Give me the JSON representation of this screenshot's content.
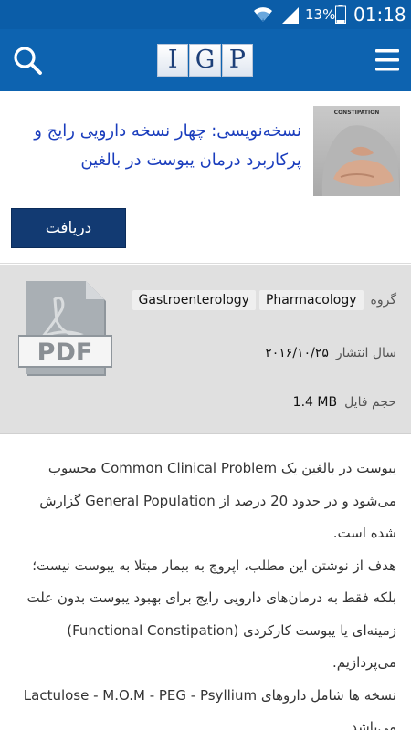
{
  "status_bar": {
    "battery_percent": "13%",
    "time": "01:18",
    "icons": [
      "wifi-icon",
      "signal-icon",
      "battery-icon"
    ]
  },
  "app_bar": {
    "logo_letters": [
      "I",
      "G",
      "P"
    ],
    "search_icon": "search-icon",
    "menu_icon": "hamburger-menu-icon",
    "background_color": "#0d63b0"
  },
  "article": {
    "title": "نسخه‌نویسی: چهار نسخه دارویی رایج و پرکاربرد درمان یبوست در بالغین",
    "thumbnail_caption": "CONSTIPATION",
    "download_label": "دریافت"
  },
  "info": {
    "group_label": "گروه",
    "groups": [
      "Pharmacology",
      "Gastroenterology"
    ],
    "date_label": "سال انتشار",
    "date_value": "۲۰۱۶/۱۰/۲۵",
    "size_label": "حجم فایل",
    "size_value": "1.4 MB",
    "file_type_label": "PDF"
  },
  "body": {
    "paragraphs": [
      "یبوست در بالغین یک Common Clinical Problem محسوب می‌شود و در حدود 20 درصد از General Population گزارش شده است.",
      "هدف از نوشتن این مطلب، اپروچ به بیمار مبتلا به یبوست نیست؛ بلکه فقط به درمان‌های دارویی رایج برای بهبود یبوست بدون علت زمینه‌ای یا یبوست کارکردی (Functional Constipation) می‌پردازیم.",
      "نسخه ها شامل داروهای Lactulose - M.O.M - PEG - Psyllium می‌باشد."
    ]
  }
}
